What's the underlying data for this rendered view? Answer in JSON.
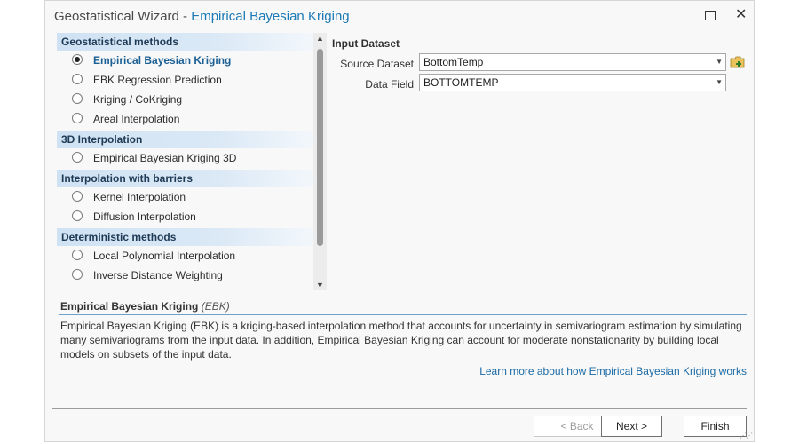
{
  "window": {
    "title_prefix": "Geostatistical Wizard",
    "title_separator": "-",
    "title_method": "Empirical Bayesian Kriging",
    "maximize_icon": "maximize-icon",
    "close_icon": "close-icon"
  },
  "methods": {
    "categories": [
      {
        "label": "Geostatistical methods",
        "items": [
          {
            "label": "Empirical Bayesian Kriging",
            "selected": true
          },
          {
            "label": "EBK Regression Prediction",
            "selected": false
          },
          {
            "label": "Kriging / CoKriging",
            "selected": false
          },
          {
            "label": "Areal Interpolation",
            "selected": false
          }
        ]
      },
      {
        "label": "3D Interpolation",
        "items": [
          {
            "label": "Empirical Bayesian Kriging 3D",
            "selected": false
          }
        ]
      },
      {
        "label": "Interpolation with barriers",
        "items": [
          {
            "label": "Kernel Interpolation",
            "selected": false
          },
          {
            "label": "Diffusion Interpolation",
            "selected": false
          }
        ]
      },
      {
        "label": "Deterministic methods",
        "items": [
          {
            "label": "Local Polynomial Interpolation",
            "selected": false
          },
          {
            "label": "Inverse Distance Weighting",
            "selected": false
          }
        ]
      }
    ]
  },
  "input": {
    "section_title": "Input Dataset",
    "source_label": "Source Dataset",
    "source_value": "BottomTemp",
    "field_label": "Data Field",
    "field_value": "BOTTOMTEMP",
    "add_data_icon": "folder-add-icon"
  },
  "description": {
    "title": "Empirical Bayesian Kriging",
    "abbr": "(EBK)",
    "text": "Empirical Bayesian Kriging (EBK) is a kriging-based interpolation method that accounts for uncertainty in semivariogram estimation by simulating many semivariograms from the input data. In addition, Empirical Bayesian Kriging can account for moderate nonstationarity by building local models on subsets of the input data.",
    "link": "Learn more about how Empirical Bayesian Kriging works"
  },
  "buttons": {
    "back": "< Back",
    "next": "Next >",
    "finish": "Finish"
  },
  "colors": {
    "accent": "#1b79b5",
    "link": "#1b6aa5",
    "category_bg": "#cfe2f3"
  }
}
